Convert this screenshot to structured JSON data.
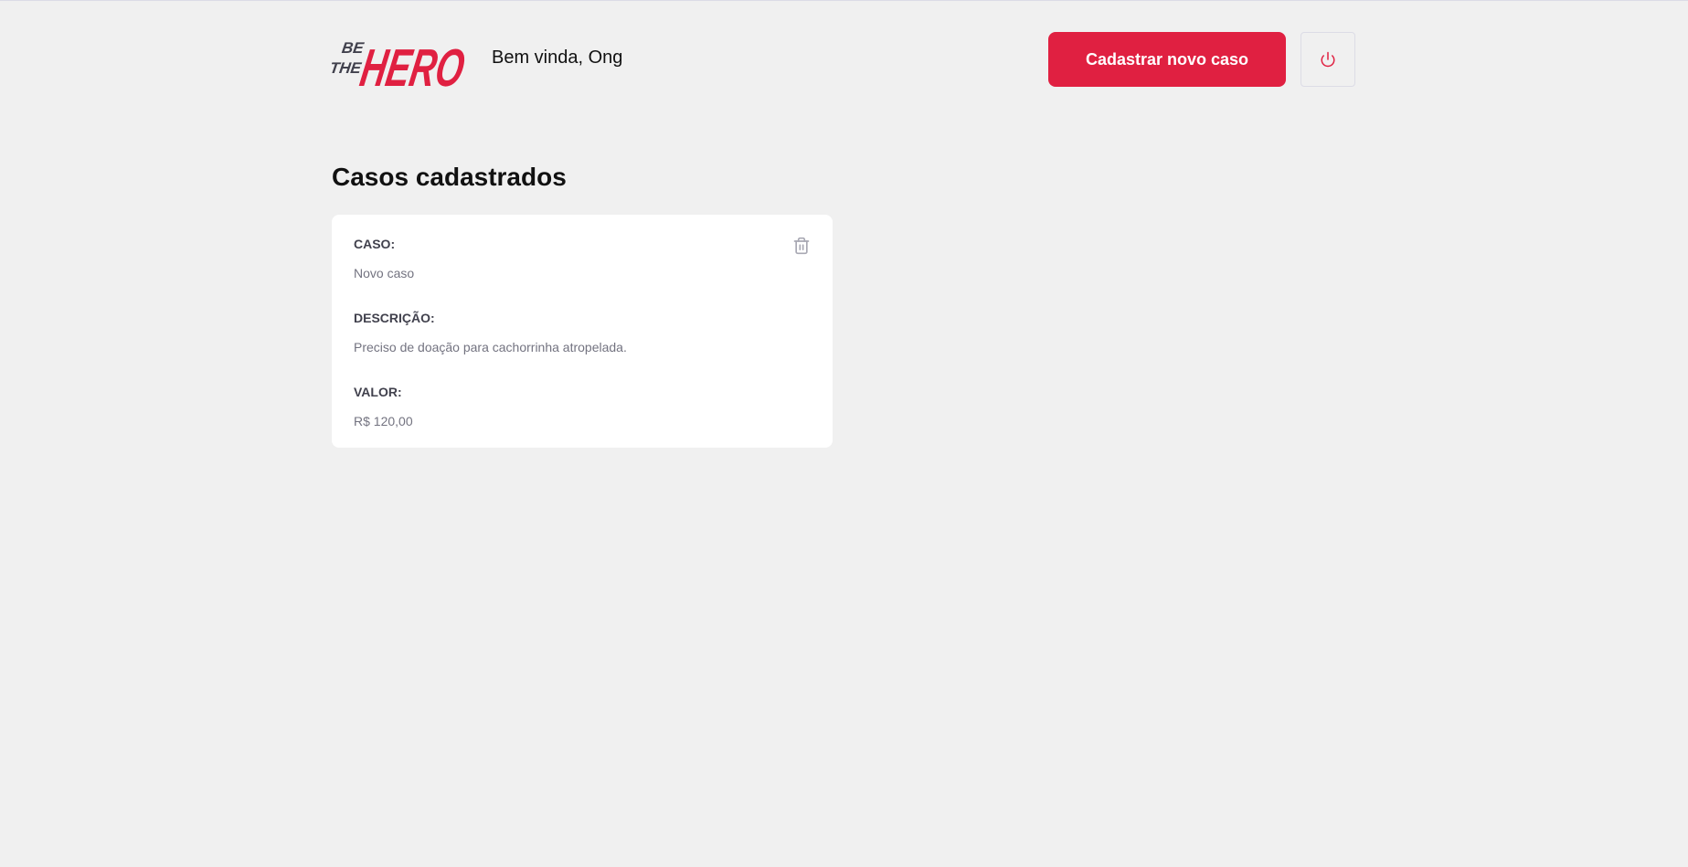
{
  "header": {
    "logo_top": "BE",
    "logo_mid": "THE",
    "logo_main": "HERO",
    "welcome": "Bem vinda, Ong",
    "new_case_label": "Cadastrar novo caso"
  },
  "main": {
    "title": "Casos cadastrados",
    "cases": [
      {
        "case_label": "CASO:",
        "case_value": "Novo caso",
        "description_label": "DESCRIÇÃO:",
        "description_value": "Preciso de doação para cachorrinha atropelada.",
        "value_label": "VALOR:",
        "value_value": "R$ 120,00"
      }
    ]
  },
  "colors": {
    "brand": "#e02041",
    "background": "#f0f0f0",
    "card": "#ffffff",
    "label": "#41414d",
    "muted": "#737380"
  },
  "icons": {
    "logout": "power-icon",
    "delete": "trash-icon"
  }
}
